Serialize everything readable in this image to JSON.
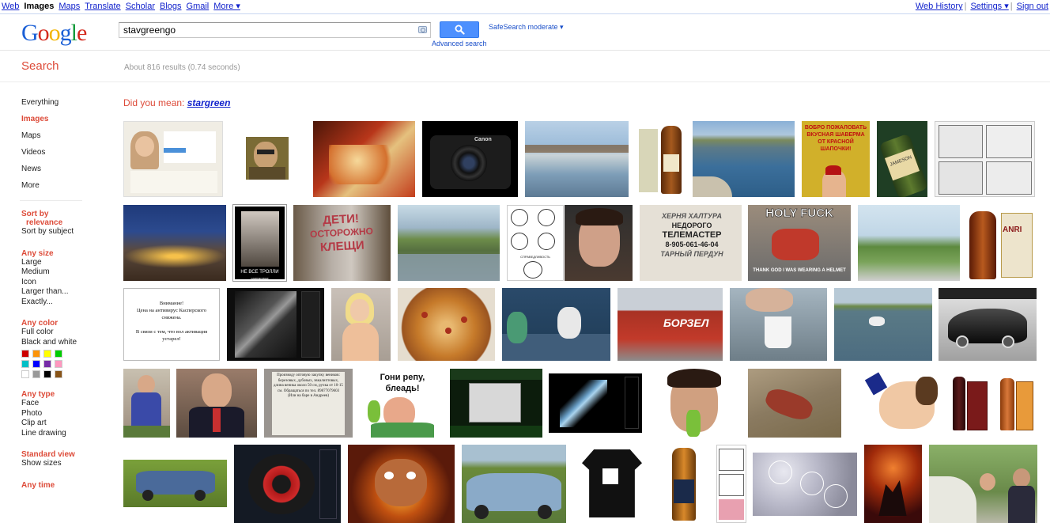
{
  "topbar": {
    "left": [
      {
        "label": "Web",
        "current": false
      },
      {
        "label": "Images",
        "current": true
      },
      {
        "label": "Maps",
        "current": false
      },
      {
        "label": "Translate",
        "current": false
      },
      {
        "label": "Scholar",
        "current": false
      },
      {
        "label": "Blogs",
        "current": false
      },
      {
        "label": "Gmail",
        "current": false
      },
      {
        "label": "More ▾",
        "current": false
      }
    ],
    "right": [
      "Web History",
      "Settings ▾",
      "Sign out"
    ]
  },
  "search": {
    "query": "stavgreengo",
    "advanced_label": "Advanced search",
    "safesearch_label": "SafeSearch moderate ▾"
  },
  "page": {
    "section_title": "Search",
    "result_stats": "About 816 results (0.74 seconds)"
  },
  "suggestion": {
    "prefix": "Did you mean:",
    "term": "stargreen"
  },
  "leftnav": {
    "types": [
      "Everything",
      "Images",
      "Maps",
      "Videos",
      "News",
      "More"
    ],
    "selected_type": "Images",
    "sort_title_1": "Sort by",
    "sort_title_2": "relevance",
    "sort_other": "Sort by subject",
    "size_title": "Any size",
    "sizes": [
      "Large",
      "Medium",
      "Icon",
      "Larger than...",
      "Exactly..."
    ],
    "color_title": "Any color",
    "colors_opts": [
      "Full color",
      "Black and white"
    ],
    "swatch_colors": [
      "#cc0000",
      "#fb940b",
      "#ffff00",
      "#00cc00",
      "#03c0c6",
      "#0000ff",
      "#762ca7",
      "#ff98bf",
      "#ffffff",
      "#999999",
      "#000000",
      "#885418"
    ],
    "type_title": "Any type",
    "types_opts": [
      "Face",
      "Photo",
      "Clip art",
      "Line drawing"
    ],
    "view_title": "Standard view",
    "view_opts": [
      "Show sizes"
    ],
    "time_title": "Any time"
  },
  "thumbnail_overlays": {
    "holy": "HOLY FUCK",
    "holy_bottom": "THANK GOD I WAS WEARING A HELMET",
    "tele1": "ХЕРНЯ ХАЛТУРА",
    "tele2": "НЕДОРОГО",
    "tele3": "ТЕЛЕМАСТЕР",
    "tele4": "8-905-061-46-04",
    "tele5": "ТАРНЫЙ ПЕРДУН",
    "deti1": "ДЕТИ!",
    "deti2": "ОСТОРОЖНО",
    "deti3": "КЛЕЩИ",
    "vnimanie": "Внимание!\nЦена на антивирус Касперского снижена.\n\nВ связи с тем, что вол активация устарел!",
    "goni": "Гони репу, блеадь!",
    "borzel": "БОРЗЕЛ",
    "shaverma": "ВОБРО ПОЖАЛОВАТЬ ВКУСНАЯ ШАВЕРМА ОТ КРАСНОЙ ШАПОЧКИ!",
    "anri": "ANRI",
    "canon": "Canon",
    "jameson": "JAMESON",
    "troll_caption": "НЕ ВСЕ ТРОЛЛИ",
    "troll_sub": "одинаковые",
    "spravedlivost": "СПРАВЕДЛИВОСТЬ",
    "kupit": "Производу оптовую закупку веников: березовых, дубовых, эвкалиптовых, длина веника около 50 см, ручка от 10-15 см. Обращаться по тел. 89877079603 (Или на баре в Андреев)"
  }
}
